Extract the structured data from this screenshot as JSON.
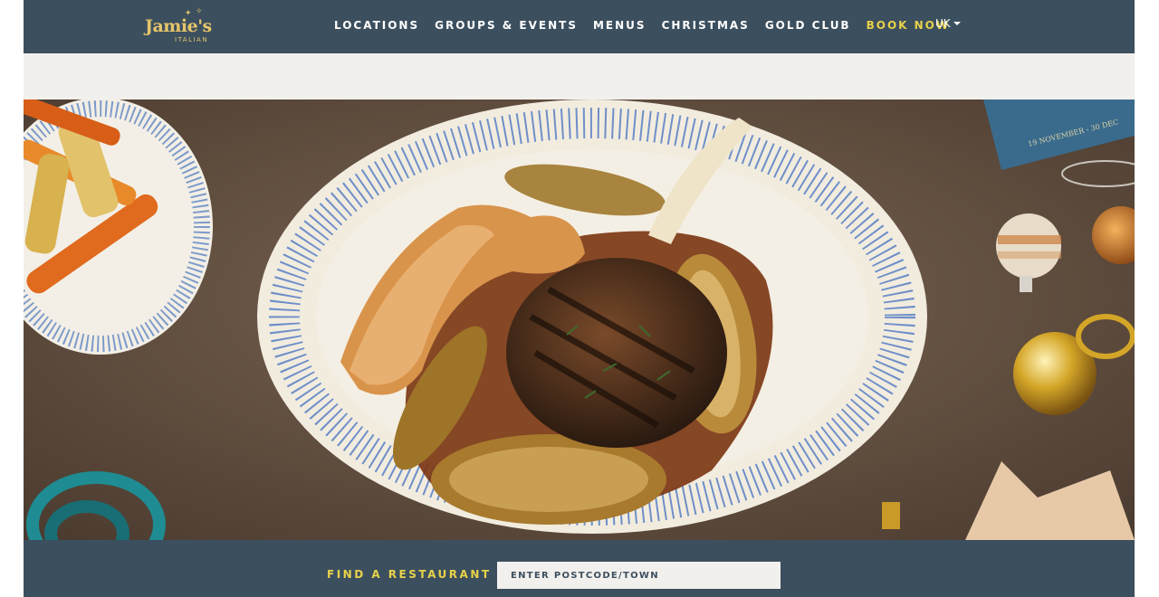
{
  "brand": {
    "logo_main": "Jamie's",
    "logo_sub": "ITALIAN"
  },
  "nav": {
    "items": [
      "LOCATIONS",
      "GROUPS & EVENTS",
      "MENUS",
      "CHRISTMAS",
      "GOLD CLUB"
    ],
    "cta": "BOOK NOW",
    "locale": "UK"
  },
  "hero": {
    "image": "christmas-pork-chop-dish-photo",
    "card_text": "19 NOVEMBER - 30 DEC"
  },
  "finder": {
    "label": "FIND A RESTAURANT",
    "placeholder": "ENTER POSTCODE/TOWN"
  },
  "colors": {
    "header": "#3c4f5e",
    "accent": "#e8d24a",
    "logo": "#e6c56a",
    "band": "#f2f0ed"
  }
}
